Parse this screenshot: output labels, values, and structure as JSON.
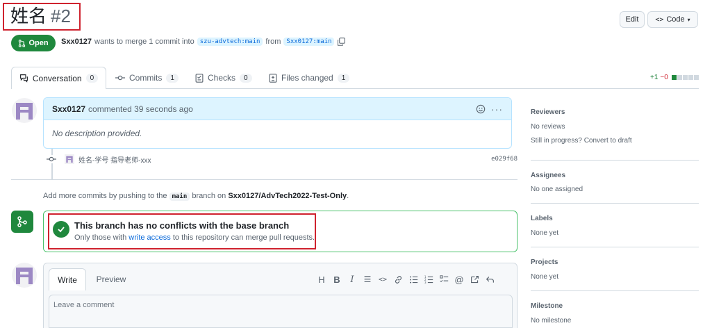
{
  "pr": {
    "title": "姓名",
    "number": "#2",
    "state": "Open",
    "author": "Sxx0127",
    "merge_text": "wants to merge 1 commit into",
    "base_branch": "szu-advtech:main",
    "from_text": "from",
    "head_branch": "Sxx0127:main"
  },
  "header_buttons": {
    "edit": "Edit",
    "code": "Code"
  },
  "tabs": [
    {
      "label": "Conversation",
      "count": "0"
    },
    {
      "label": "Commits",
      "count": "1"
    },
    {
      "label": "Checks",
      "count": "0"
    },
    {
      "label": "Files changed",
      "count": "1"
    }
  ],
  "diffstat": {
    "additions": "+1",
    "deletions": "−0"
  },
  "comment": {
    "author": "Sxx0127",
    "action": "commented 39 seconds ago",
    "body": "No description provided."
  },
  "commit": {
    "message": "姓名-学号 指导老师-xxx",
    "sha": "e029f68"
  },
  "push_hint": {
    "prefix": "Add more commits by pushing to the",
    "branch": "main",
    "middle": "branch on",
    "repo": "Sxx0127/AdvTech2022-Test-Only",
    "suffix": "."
  },
  "merge_status": {
    "title": "This branch has no conflicts with the base branch",
    "sub_prefix": "Only those with",
    "link": "write access",
    "sub_suffix": "to this repository can merge pull requests."
  },
  "composer": {
    "write_tab": "Write",
    "preview_tab": "Preview",
    "placeholder": "Leave a comment",
    "toolbar_icons": [
      "heading-icon",
      "bold-icon",
      "italic-icon",
      "quote-icon",
      "code-icon",
      "link-icon",
      "unordered-list-icon",
      "ordered-list-icon",
      "task-list-icon",
      "mention-icon",
      "cross-reference-icon",
      "reply-icon"
    ]
  },
  "sidebar": {
    "reviewers": {
      "title": "Reviewers",
      "value": "No reviews",
      "note": "Still in progress?",
      "link": "Convert to draft"
    },
    "assignees": {
      "title": "Assignees",
      "value": "No one assigned"
    },
    "labels": {
      "title": "Labels",
      "value": "None yet"
    },
    "projects": {
      "title": "Projects",
      "value": "None yet"
    },
    "milestone": {
      "title": "Milestone",
      "value": "No milestone"
    }
  },
  "colors": {
    "accent_green": "#1f883d",
    "highlight_red": "#cf222e",
    "link_blue": "#0969da"
  }
}
